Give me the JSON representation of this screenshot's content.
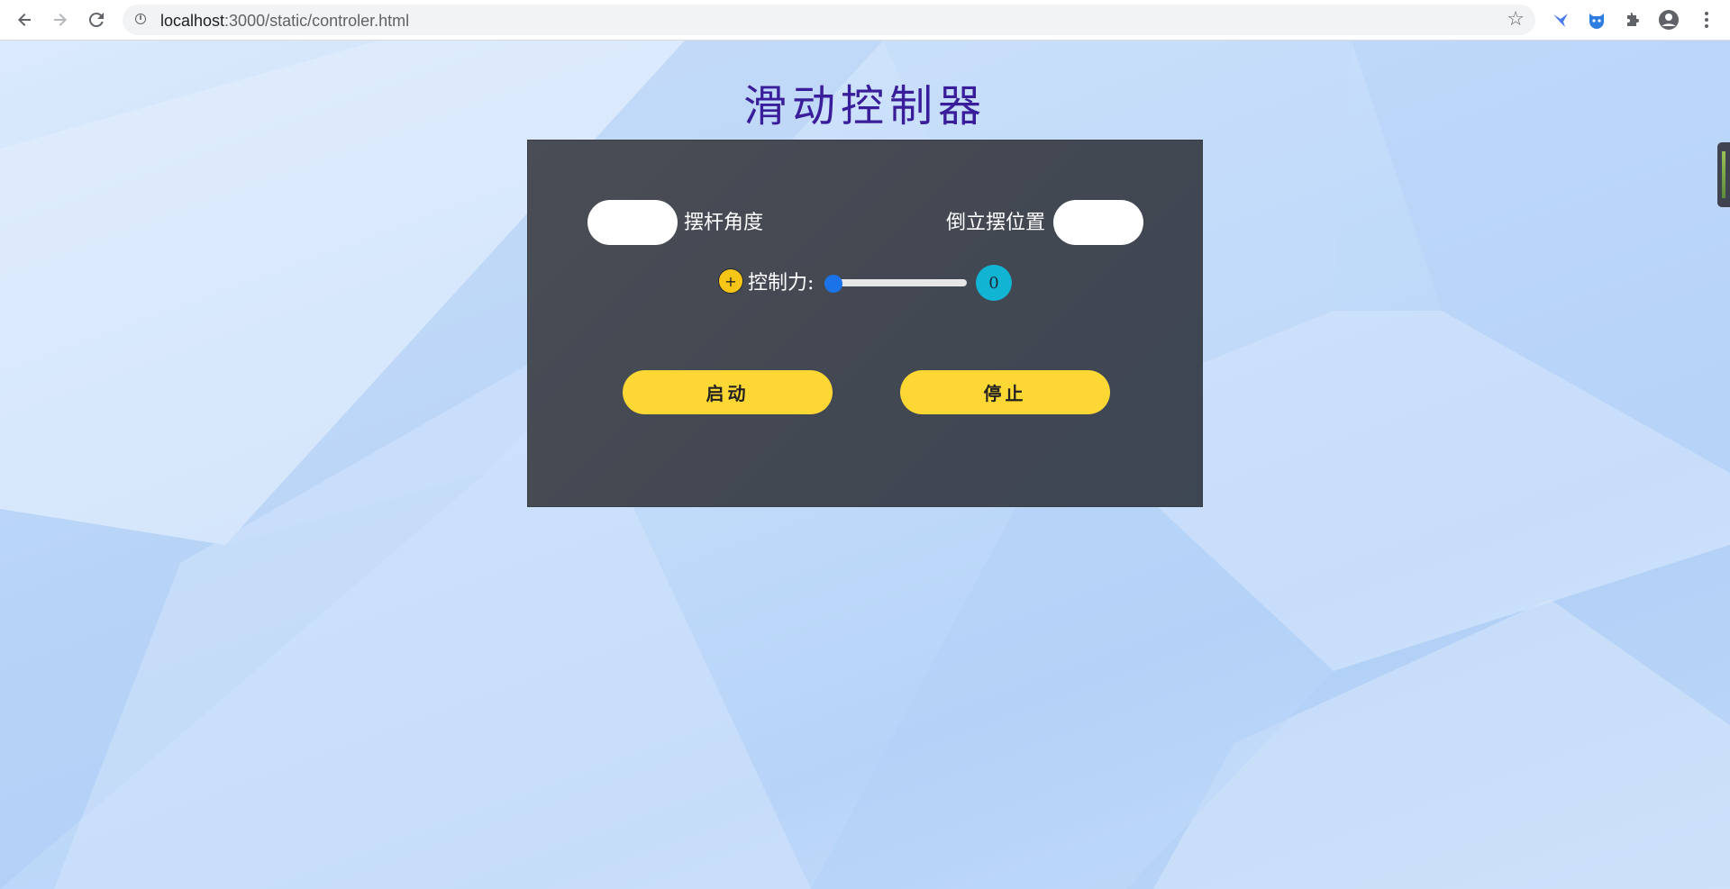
{
  "browser": {
    "url_host": "localhost",
    "url_path": ":3000/static/controler.html",
    "icons": {
      "back": "back-arrow-icon",
      "forward": "forward-arrow-icon",
      "reload": "reload-icon",
      "info": "info-icon",
      "star": "star-icon",
      "ext1": "kite-extension-icon",
      "ext2": "cat-extension-icon",
      "ext3": "puzzle-extensions-icon",
      "profile": "profile-avatar-icon",
      "menu": "kebab-menu-icon"
    }
  },
  "app": {
    "title": "滑动控制器",
    "pendulum_angle": {
      "label": "摆杆角度",
      "value": ""
    },
    "inverted_position": {
      "label": "倒立摆位置",
      "value": ""
    },
    "control_force": {
      "plus_label": "+",
      "label": "控制力:",
      "value": 0,
      "min": 0,
      "max": 100,
      "display": "0"
    },
    "buttons": {
      "start": "启动",
      "stop": "停止"
    }
  },
  "colors": {
    "title": "#3a1d9a",
    "panel": "#444953",
    "button": "#fdd835",
    "slider": "#1a73e8",
    "badge": "#12b4d4"
  }
}
